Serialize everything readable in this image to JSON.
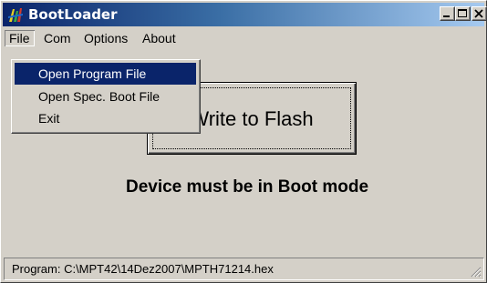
{
  "window": {
    "title": "BootLoader"
  },
  "menubar": {
    "items": [
      {
        "label": "File"
      },
      {
        "label": "Com"
      },
      {
        "label": "Options"
      },
      {
        "label": "About"
      }
    ]
  },
  "file_menu": {
    "open": true,
    "items": [
      {
        "label": "Open Program File",
        "selected": true
      },
      {
        "label": "Open Spec. Boot File",
        "selected": false
      },
      {
        "label": "Exit",
        "selected": false
      }
    ]
  },
  "main": {
    "write_button_label": "Write to Flash",
    "device_message": "Device must be in Boot mode"
  },
  "statusbar": {
    "text": "Program: C:\\MPT42\\14Dez2007\\MPTH71214.hex"
  },
  "colors": {
    "titlebar_start": "#0a246a",
    "titlebar_end": "#a6caf0",
    "face": "#d4d0c8",
    "selection": "#0a246a"
  },
  "icons": {
    "app": "bootloader-app-icon",
    "minimize": "minimize-icon",
    "maximize": "maximize-icon",
    "close": "close-icon",
    "grip": "resize-grip-icon"
  }
}
